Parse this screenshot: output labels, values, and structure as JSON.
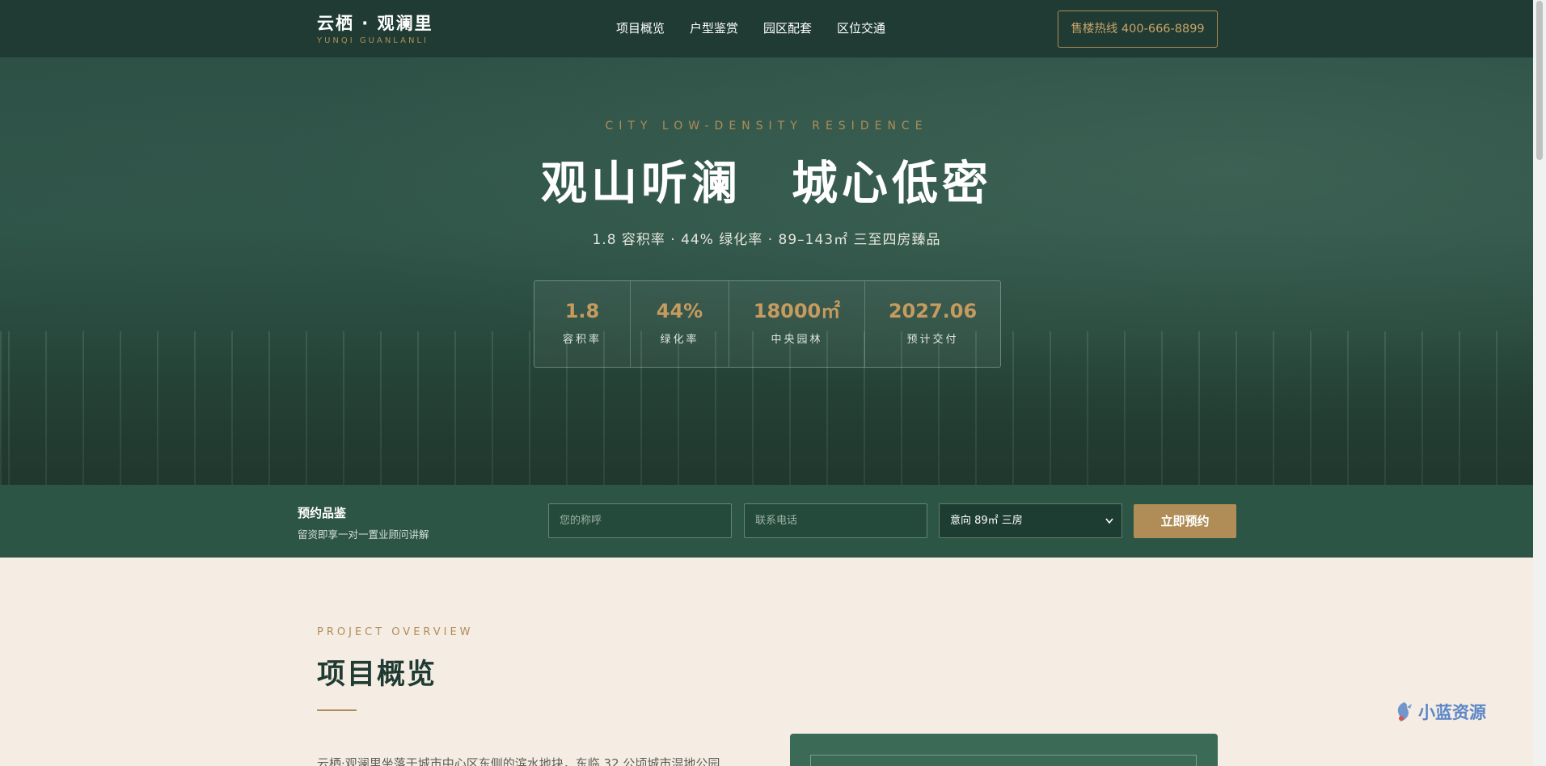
{
  "header": {
    "logo_main": "云栖 · 观澜里",
    "logo_sub": "YUNQI GUANLANLI",
    "nav": [
      "项目概览",
      "户型鉴赏",
      "园区配套",
      "区位交通"
    ],
    "hotline": "售楼热线 400-666-8899"
  },
  "hero": {
    "eyebrow": "CITY LOW-DENSITY RESIDENCE",
    "title": "观山听澜　城心低密",
    "subtitle": "1.8 容积率 · 44% 绿化率 · 89–143㎡ 三至四房臻品",
    "stats": [
      {
        "value": "1.8",
        "label": "容积率"
      },
      {
        "value": "44%",
        "label": "绿化率"
      },
      {
        "value": "18000㎡",
        "label": "中央园林"
      },
      {
        "value": "2027.06",
        "label": "预计交付"
      }
    ]
  },
  "booking": {
    "title": "预约品鉴",
    "desc": "留资即享一对一置业顾问讲解",
    "name_placeholder": "您的称呼",
    "phone_placeholder": "联系电话",
    "select_value": "意向 89㎡ 三房",
    "submit": "立即预约"
  },
  "overview": {
    "eyebrow": "PROJECT OVERVIEW",
    "title": "项目概览",
    "text": "云栖·观澜里坐落于城市中心区东侧的滨水地块，东临 32 公顷城市湿地公园"
  },
  "watermark": "小蓝资源",
  "colors": {
    "primary_green": "#1f3b33",
    "accent_gold": "#b08d57",
    "cream_bg": "#f5ede3"
  }
}
